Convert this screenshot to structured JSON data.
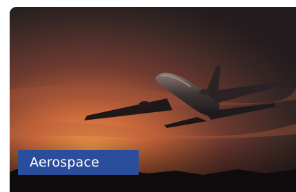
{
  "card": {
    "category_label": "Aerospace",
    "image_subject": "airplane-at-sunset",
    "colors": {
      "badge_background": "#2a4d9c",
      "badge_text": "#ffffff",
      "sky_glow": "#e07a3a",
      "sky_dark": "#2a1e1c"
    }
  }
}
